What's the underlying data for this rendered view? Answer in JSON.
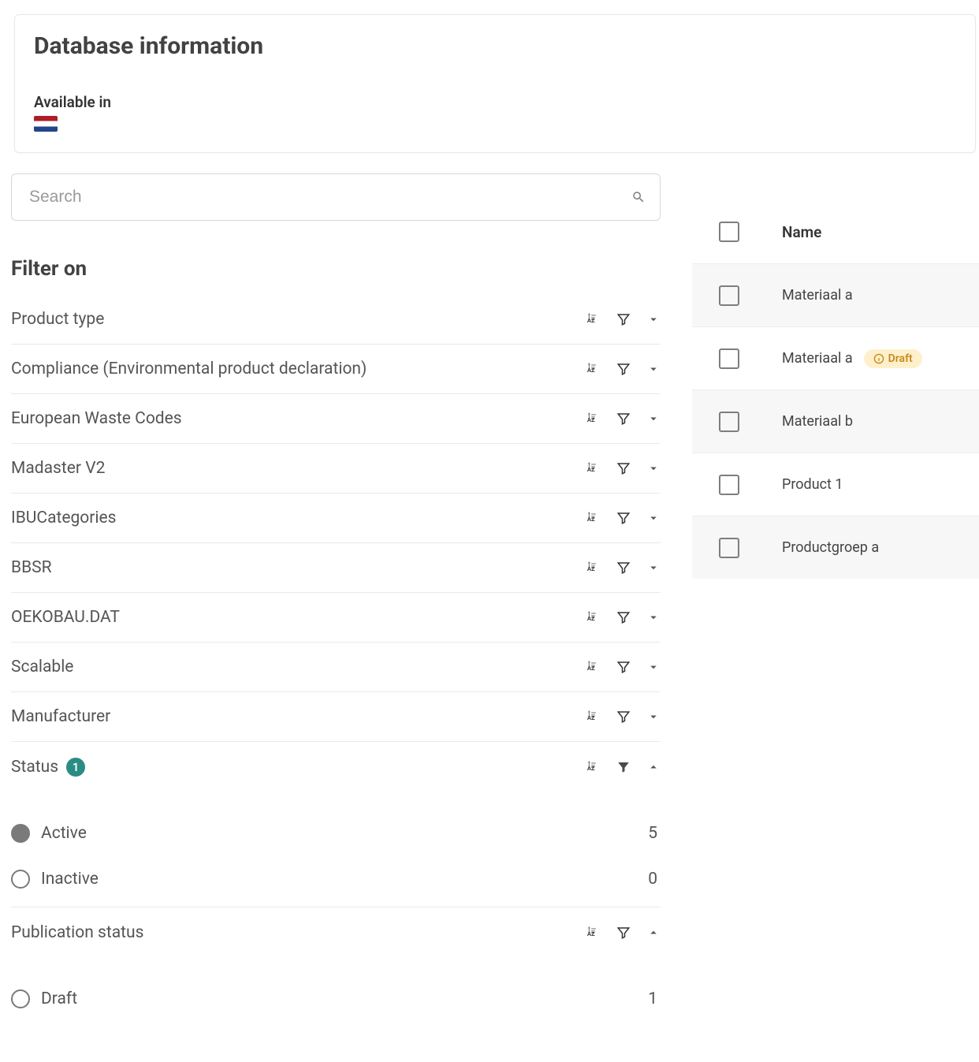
{
  "card": {
    "title": "Database information",
    "availableLabel": "Available in"
  },
  "search": {
    "placeholder": "Search"
  },
  "filter": {
    "heading": "Filter on",
    "rows": [
      {
        "label": "Product type"
      },
      {
        "label": "Compliance (Environmental product declaration)"
      },
      {
        "label": "European Waste Codes"
      },
      {
        "label": "Madaster V2"
      },
      {
        "label": "IBUCategories"
      },
      {
        "label": "BBSR"
      },
      {
        "label": "OEKOBAU.DAT"
      },
      {
        "label": "Scalable"
      },
      {
        "label": "Manufacturer"
      }
    ],
    "status": {
      "label": "Status",
      "badge": "1",
      "options": [
        {
          "label": "Active",
          "count": "5",
          "selected": true
        },
        {
          "label": "Inactive",
          "count": "0",
          "selected": false
        }
      ]
    },
    "publication": {
      "label": "Publication status",
      "options": [
        {
          "label": "Draft",
          "count": "1",
          "selected": false
        }
      ]
    }
  },
  "table": {
    "headerName": "Name",
    "rows": [
      {
        "name": "Materiaal a",
        "draft": false
      },
      {
        "name": "Materiaal a",
        "draft": true
      },
      {
        "name": "Materiaal b",
        "draft": false
      },
      {
        "name": "Product 1",
        "draft": false
      },
      {
        "name": "Productgroep a",
        "draft": false
      }
    ],
    "draftLabel": "Draft"
  }
}
